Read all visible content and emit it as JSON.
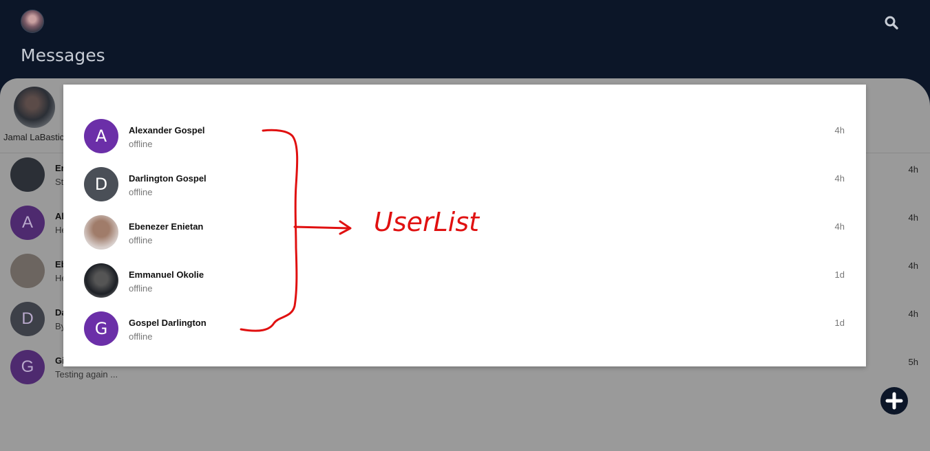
{
  "header": {
    "title": "Messages",
    "search_icon": "search-icon"
  },
  "story": {
    "name": "Jamal LaBastic"
  },
  "background_list": [
    {
      "initial": "",
      "name": "Er",
      "message": "St",
      "time": "4h",
      "avatar_color": "#2b2f36"
    },
    {
      "initial": "A",
      "name": "Al",
      "message": "He",
      "time": "4h",
      "avatar_color": "#4e2a6f"
    },
    {
      "initial": "",
      "name": "Eb",
      "message": "He",
      "time": "4h",
      "avatar_color": "#6c6560"
    },
    {
      "initial": "D",
      "name": "Da",
      "message": "By",
      "time": "4h",
      "avatar_color": "#3d4048"
    },
    {
      "initial": "G",
      "name": "Gi",
      "message": "Testing again ...",
      "time": "5h",
      "avatar_color": "#4e2a6f"
    }
  ],
  "fab": {
    "icon": "plus-icon"
  },
  "user_list": [
    {
      "initial": "A",
      "name": "Alexander Gospel",
      "status": "offline",
      "time": "4h",
      "avatar_color": "#6b2fa8"
    },
    {
      "initial": "D",
      "name": "Darlington Gospel",
      "status": "offline",
      "time": "4h",
      "avatar_color": "#4a4f57"
    },
    {
      "initial": "",
      "name": "Ebenezer Enietan",
      "status": "offline",
      "time": "4h",
      "avatar_color": "#b89a8c"
    },
    {
      "initial": "",
      "name": "Emmanuel Okolie",
      "status": "offline",
      "time": "1d",
      "avatar_color": "#2b2f36"
    },
    {
      "initial": "G",
      "name": "Gospel Darlington",
      "status": "offline",
      "time": "1d",
      "avatar_color": "#6b2fa8"
    }
  ],
  "annotation": {
    "label": "UserList",
    "color": "#e01010"
  }
}
